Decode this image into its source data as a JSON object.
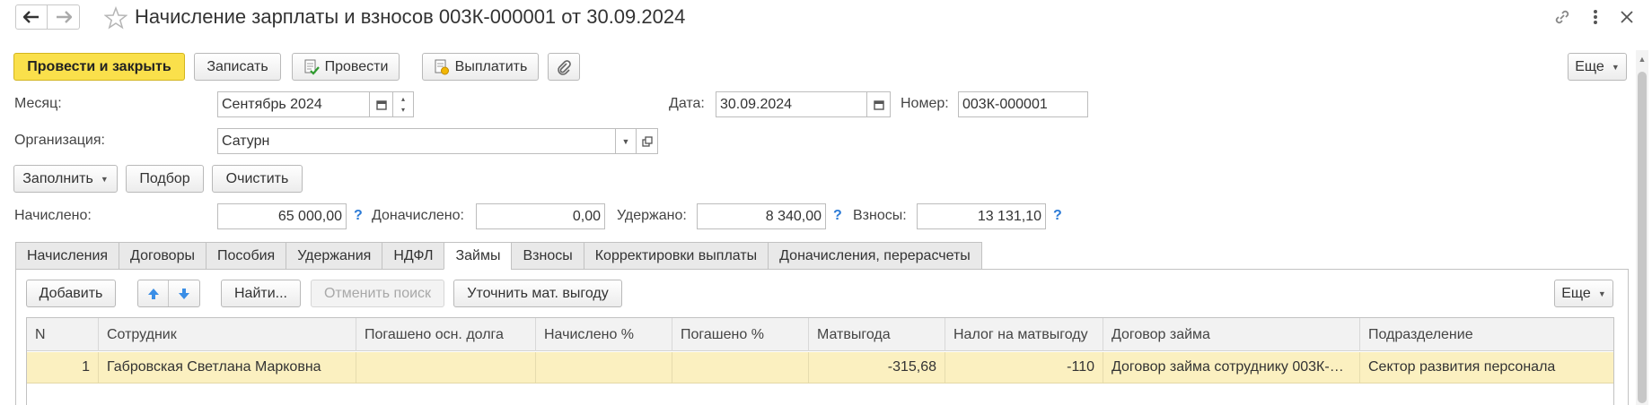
{
  "window": {
    "title": "Начисление зарплаты и взносов 003К-000001 от 30.09.2024"
  },
  "toolbar": {
    "post_close": "Провести и закрыть",
    "save": "Записать",
    "post": "Провести",
    "pay": "Выплатить",
    "more": "Еще"
  },
  "form": {
    "month_label": "Месяц:",
    "month_value": "Сентябрь 2024",
    "date_label": "Дата:",
    "date_value": "30.09.2024",
    "number_label": "Номер:",
    "number_value": "003К-000001",
    "org_label": "Организация:",
    "org_value": "Сатурн"
  },
  "actions": {
    "fill": "Заполнить",
    "select": "Подбор",
    "clear": "Очистить"
  },
  "totals": {
    "accrued_label": "Начислено:",
    "accrued_value": "65 000,00",
    "additional_label": "Доначислено:",
    "additional_value": "0,00",
    "withheld_label": "Удержано:",
    "withheld_value": "8 340,00",
    "contrib_label": "Взносы:",
    "contrib_value": "13 131,10",
    "help": "?"
  },
  "tabs": [
    {
      "label": "Начисления"
    },
    {
      "label": "Договоры"
    },
    {
      "label": "Пособия"
    },
    {
      "label": "Удержания"
    },
    {
      "label": "НДФЛ"
    },
    {
      "label": "Займы"
    },
    {
      "label": "Взносы"
    },
    {
      "label": "Корректировки выплаты"
    },
    {
      "label": "Доначисления, перерасчеты"
    }
  ],
  "active_tab": "Займы",
  "table_toolbar": {
    "add": "Добавить",
    "find": "Найти...",
    "cancel_search": "Отменить поиск",
    "refine": "Уточнить мат. выгоду",
    "more": "Еще"
  },
  "table": {
    "columns": [
      "N",
      "Сотрудник",
      "Погашено осн. долга",
      "Начислено %",
      "Погашено %",
      "Матвыгода",
      "Налог на матвыгоду",
      "Договор займа",
      "Подразделение"
    ],
    "rows": [
      [
        "1",
        "Габровская Светлана Марковна",
        "",
        "",
        "",
        "-315,68",
        "-110",
        "Договор займа сотруднику 003К-…",
        "Сектор развития персонала"
      ]
    ]
  },
  "colors": {
    "primary_button": "#fae04b",
    "selected_row": "#fbf0c0",
    "help_icon": "#2c7bd6",
    "arrow_button": "#3a8ee6"
  }
}
